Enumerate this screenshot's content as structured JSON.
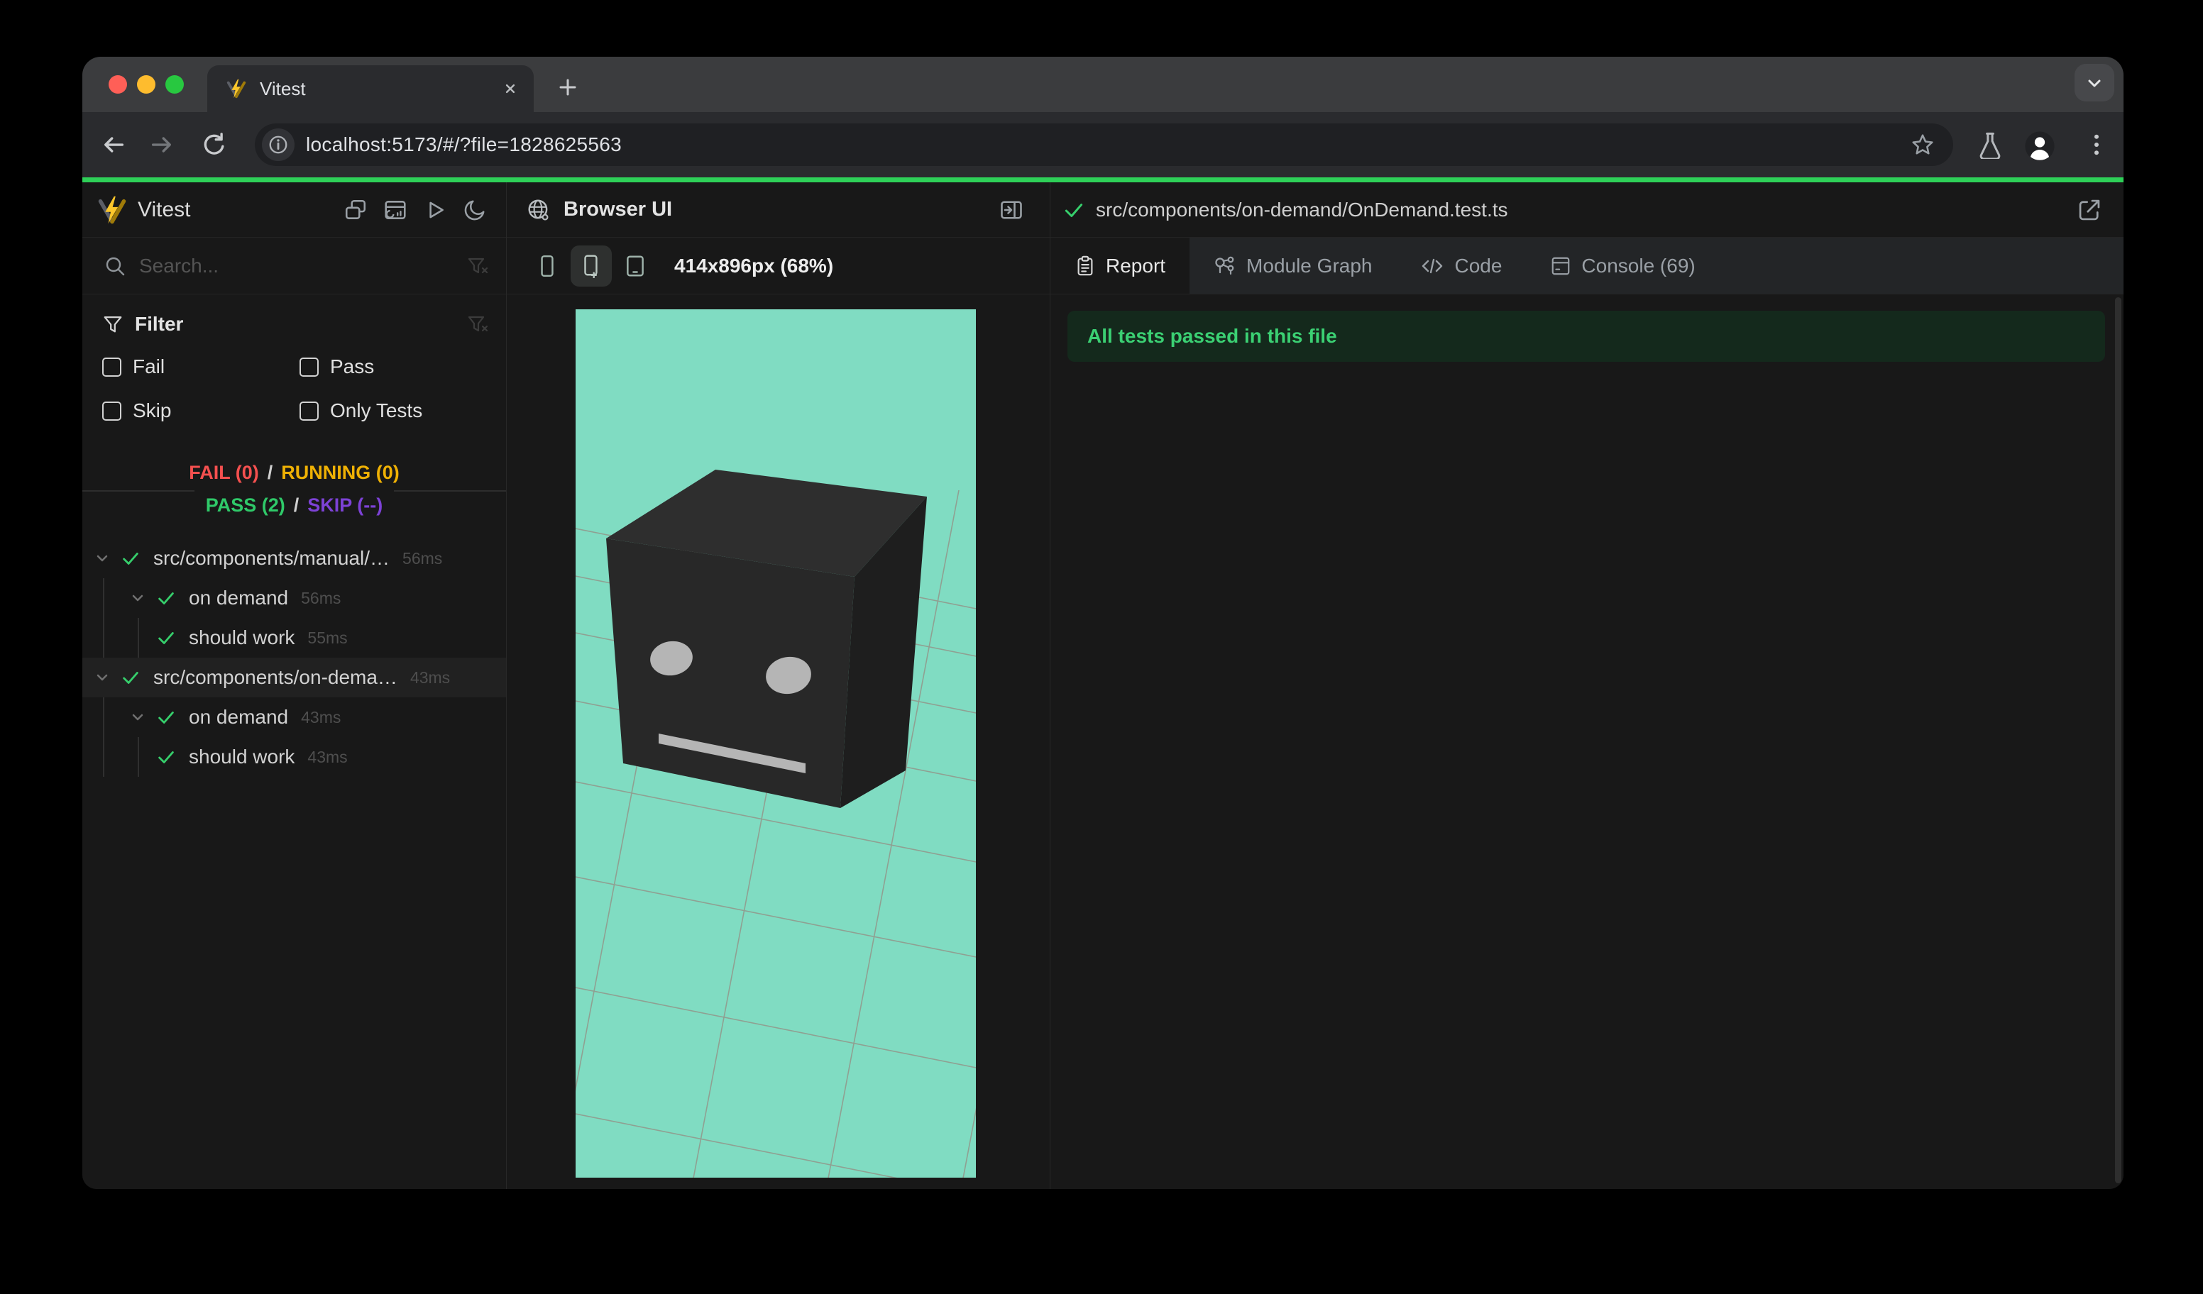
{
  "browser_chrome": {
    "tab_title": "Vitest",
    "url": "localhost:5173/#/?file=1828625563"
  },
  "sidebar": {
    "app_title": "Vitest",
    "search_placeholder": "Search...",
    "filter_title": "Filter",
    "filter_options": [
      "Fail",
      "Pass",
      "Skip",
      "Only Tests"
    ],
    "summary": {
      "fail": "FAIL (0)",
      "slash": "/",
      "running": "RUNNING (0)",
      "pass": "PASS (2)",
      "skip": "SKIP (--)"
    },
    "tree": [
      {
        "label": "src/components/manual/…",
        "duration": "56ms"
      },
      {
        "label": "on demand",
        "duration": "56ms"
      },
      {
        "label": "should work",
        "duration": "55ms"
      },
      {
        "label": "src/components/on-dema…",
        "duration": "43ms"
      },
      {
        "label": "on demand",
        "duration": "43ms"
      },
      {
        "label": "should work",
        "duration": "43ms"
      }
    ]
  },
  "browser_panel": {
    "title": "Browser UI",
    "viewport_size": "414x896px (68%)"
  },
  "test_panel": {
    "file_path": "src/components/on-demand/OnDemand.test.ts",
    "tabs": [
      "Report",
      "Module Graph",
      "Code",
      "Console (69)"
    ],
    "banner": "All tests passed in this file"
  },
  "colors": {
    "progress_green": "#2ed058",
    "pass_green": "#2fc969",
    "fail_red": "#f4504f",
    "running_yellow": "#efb104",
    "skip_purple": "#7d42d6",
    "viewport_bg": "#80dcc2"
  }
}
